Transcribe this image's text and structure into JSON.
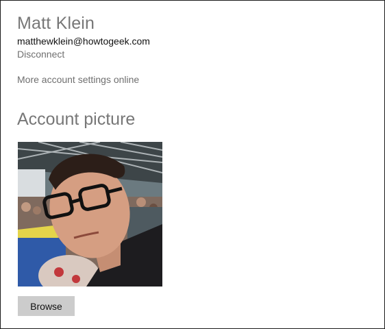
{
  "account": {
    "name": "Matt Klein",
    "email": "matthewklein@howtogeek.com",
    "disconnect_label": "Disconnect",
    "more_settings_label": "More account settings online"
  },
  "account_picture": {
    "title": "Account picture",
    "browse_label": "Browse"
  },
  "colors": {
    "heading_gray": "#777777",
    "link_gray": "#6f6f6f",
    "button_bg": "#cccccc"
  }
}
